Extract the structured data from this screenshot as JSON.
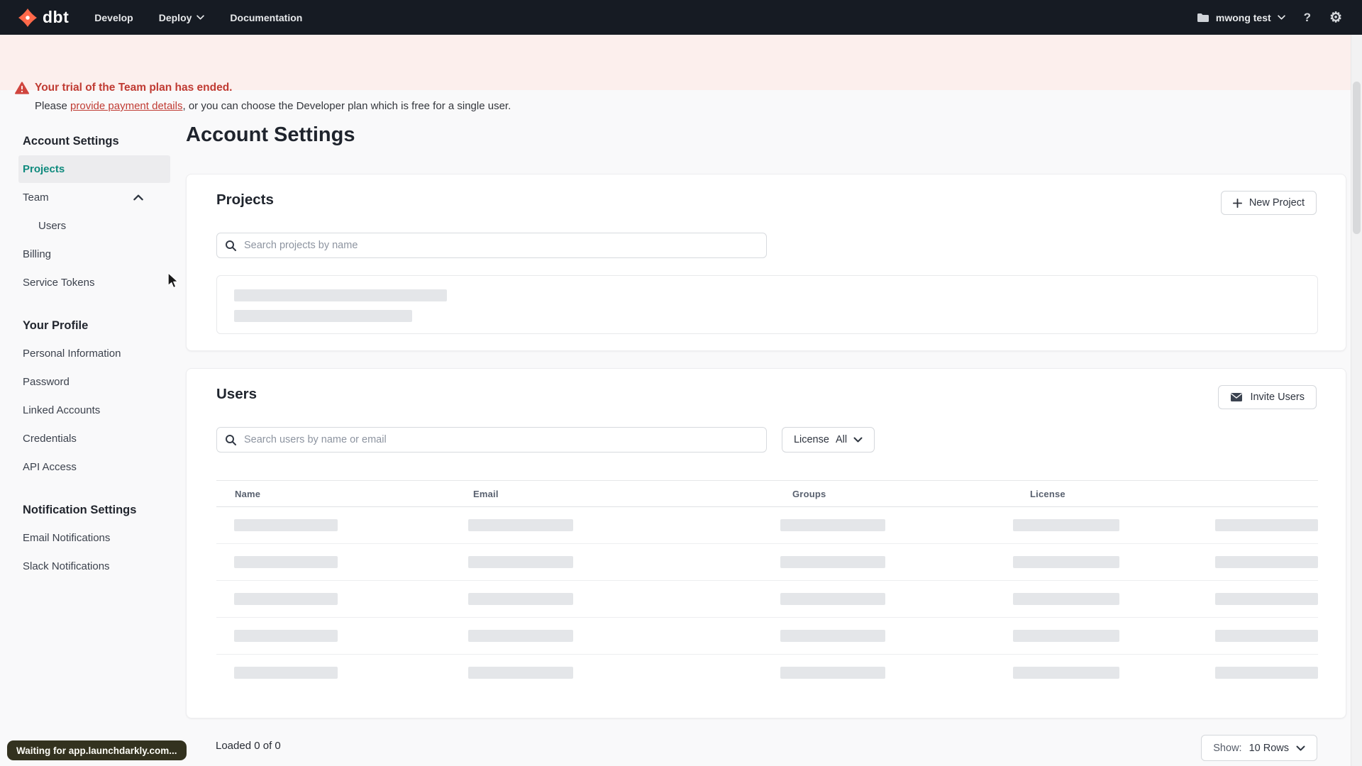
{
  "navbar": {
    "logo_text": "dbt",
    "menu": [
      {
        "label": "Develop"
      },
      {
        "label": "Deploy"
      },
      {
        "label": "Documentation"
      }
    ],
    "account_name": "mwong test",
    "help_icon": "?",
    "gear_icon": "⚙"
  },
  "banner": {
    "title": "Your trial of the Team plan has ended.",
    "body_prefix": "Please ",
    "link_text": "provide payment details",
    "body_suffix": ", or you can choose the Developer plan which is free for a single user."
  },
  "sidebar": {
    "sections": [
      {
        "heading": "Account Settings",
        "items": [
          {
            "label": "Projects",
            "active": true
          },
          {
            "label": "Team",
            "chevron": "up"
          },
          {
            "label": "Users",
            "indent": true
          },
          {
            "label": "Billing"
          },
          {
            "label": "Service Tokens"
          }
        ]
      },
      {
        "heading": "Your Profile",
        "items": [
          {
            "label": "Personal Information"
          },
          {
            "label": "Password"
          },
          {
            "label": "Linked Accounts"
          },
          {
            "label": "Credentials"
          },
          {
            "label": "API Access"
          }
        ]
      },
      {
        "heading": "Notification Settings",
        "items": [
          {
            "label": "Email Notifications"
          },
          {
            "label": "Slack Notifications"
          }
        ]
      }
    ]
  },
  "main": {
    "title": "Account Settings",
    "projects_card": {
      "heading": "Projects",
      "new_project_label": "New Project",
      "search_placeholder": "Search projects by name",
      "loading_skeleton_bars": 2
    },
    "users_card": {
      "heading": "Users",
      "invite_label": "Invite Users",
      "search_placeholder": "Search users by name or email",
      "license_filter": {
        "label": "License",
        "value": "All"
      },
      "table": {
        "columns": [
          "Name",
          "Email",
          "Groups",
          "License"
        ],
        "skeleton_rows": 5
      },
      "footer": {
        "loaded_text": "Loaded 0 of 0",
        "show_label": "Show:",
        "show_value": "10 Rows"
      }
    }
  },
  "status_toast": "Waiting for app.launchdarkly.com...",
  "colors": {
    "navbar_bg": "#161b23",
    "logo_orange": "#ff694a",
    "banner_bg": "#fcefed",
    "banner_red": "#c03b33",
    "accent_teal": "#0f8a7d",
    "skeleton_gray": "#e4e6e9"
  }
}
